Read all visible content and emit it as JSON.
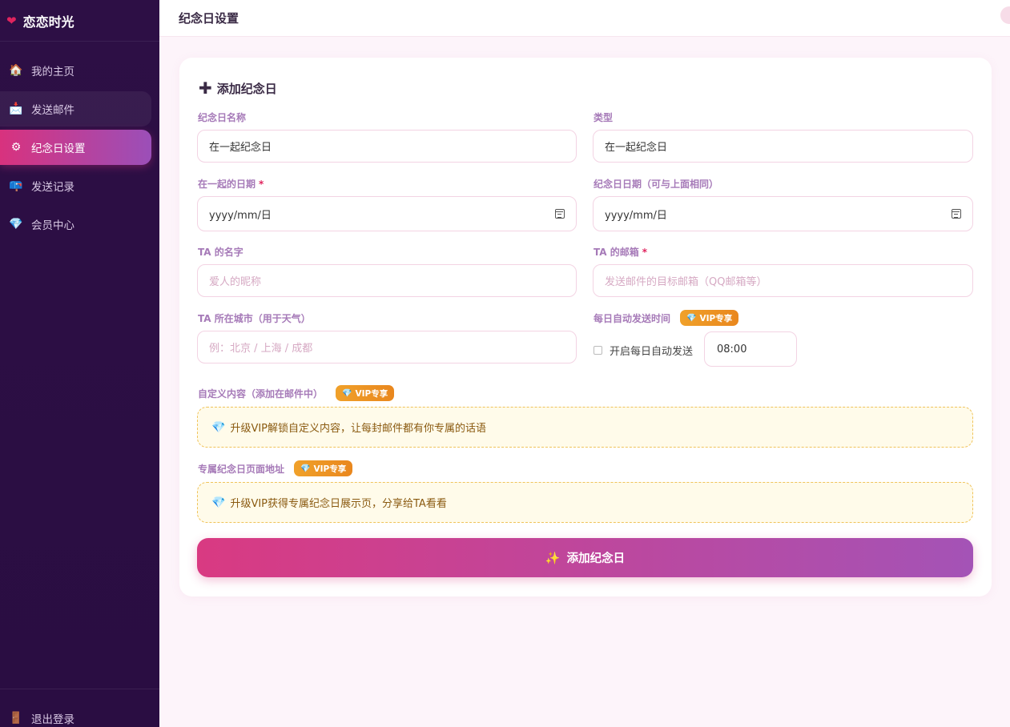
{
  "app": {
    "brand_name": "恋恋时光"
  },
  "sidebar": {
    "items": [
      {
        "label": "我的主页",
        "icon": "house-icon"
      },
      {
        "label": "发送邮件",
        "icon": "mailbox-icon"
      },
      {
        "label": "纪念日设置",
        "icon": "gear-icon"
      },
      {
        "label": "发送记录",
        "icon": "record-icon"
      },
      {
        "label": "会员中心",
        "icon": "gem-icon"
      }
    ],
    "logout_label": "退出登录"
  },
  "header": {
    "title": "纪念日设置"
  },
  "form": {
    "section_title": "添加纪念日",
    "name": {
      "label": "纪念日名称",
      "value": "在一起纪念日"
    },
    "type": {
      "label": "类型",
      "value": "在一起纪念日"
    },
    "together_date": {
      "label": "在一起的日期",
      "required_mark": "*",
      "placeholder": "yyyy/mm/日"
    },
    "anniversary_date": {
      "label": "纪念日日期（可与上面相同）",
      "placeholder": "yyyy/mm/日"
    },
    "ta_name": {
      "label": "TA 的名字",
      "placeholder": "爱人的昵称"
    },
    "ta_email": {
      "label": "TA 的邮箱",
      "required_mark": "*",
      "placeholder": "发送邮件的目标邮箱（QQ邮箱等）"
    },
    "ta_city": {
      "label": "TA 所在城市（用于天气）",
      "placeholder": "例：北京 / 上海 / 成都"
    },
    "auto_send": {
      "label": "每日自动发送时间",
      "checkbox_label": "开启每日自动发送",
      "time": "08:00",
      "checked": false
    },
    "vip_badge": "VIP专享",
    "custom_content": {
      "label": "自定义内容（添加在邮件中）",
      "notice": "升级VIP解锁自定义内容，让每封邮件都有你专属的话语"
    },
    "page_url": {
      "label": "专属纪念日页面地址",
      "notice": "升级VIP获得专属纪念日展示页，分享给TA看看"
    },
    "submit_label": "添加纪念日"
  },
  "colors": {
    "accent_start": "#d93a82",
    "accent_end": "#a453b6",
    "sidebar_bg": "#2d0f45",
    "vip": "#f0a12a"
  }
}
